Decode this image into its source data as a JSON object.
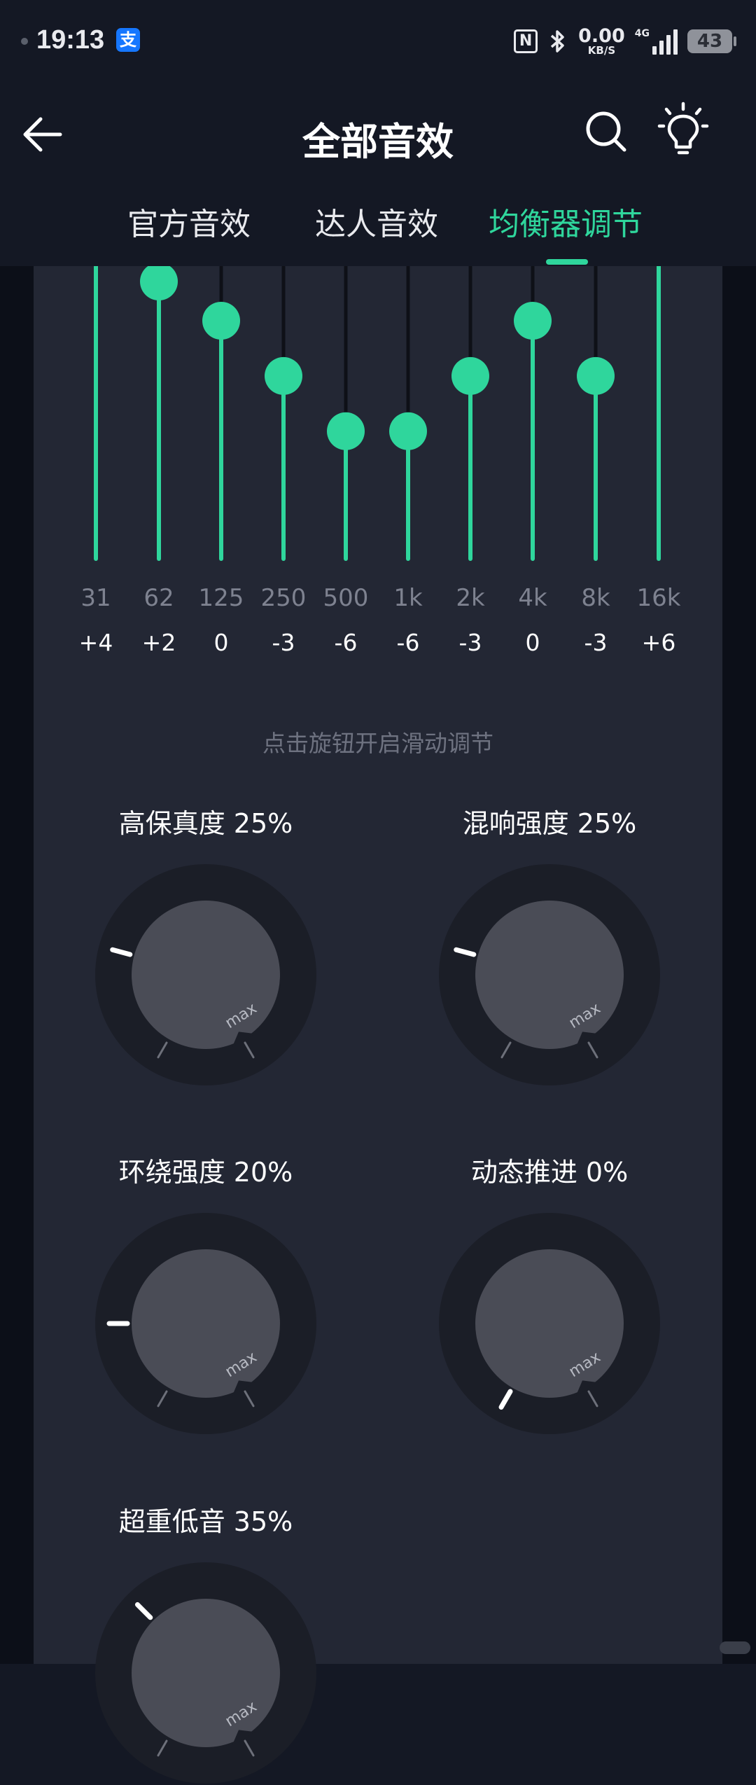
{
  "status_bar": {
    "time": "19:13",
    "alipay_glyph": "支",
    "nfc_label": "N",
    "net_speed_value": "0.00",
    "net_speed_unit": "KB/S",
    "network_type": "4G",
    "battery_level": "43"
  },
  "header": {
    "title": "全部音效",
    "back_icon": "back-arrow-icon",
    "search_icon": "search-icon",
    "tips_icon": "lightbulb-icon"
  },
  "tabs": [
    {
      "label": "官方音效",
      "active": false
    },
    {
      "label": "达人音效",
      "active": false
    },
    {
      "label": "均衡器调节",
      "active": true
    }
  ],
  "equalizer": {
    "bands": [
      {
        "freq": "31",
        "gain": "+4"
      },
      {
        "freq": "62",
        "gain": "+2"
      },
      {
        "freq": "125",
        "gain": "0"
      },
      {
        "freq": "250",
        "gain": "-3"
      },
      {
        "freq": "500",
        "gain": "-6"
      },
      {
        "freq": "1k",
        "gain": "-6"
      },
      {
        "freq": "2k",
        "gain": "-3"
      },
      {
        "freq": "4k",
        "gain": "0"
      },
      {
        "freq": "8k",
        "gain": "-3"
      },
      {
        "freq": "16k",
        "gain": "+6"
      }
    ],
    "hint": "点击旋钮开启滑动调节"
  },
  "knobs": [
    {
      "label": "高保真度 25%",
      "percent": 25
    },
    {
      "label": "混响强度 25%",
      "percent": 25
    },
    {
      "label": "环绕强度 20%",
      "percent": 20
    },
    {
      "label": "动态推进 0%",
      "percent": 0
    },
    {
      "label": "超重低音 35%",
      "percent": 35
    }
  ],
  "knob_max_label": "max",
  "colors": {
    "accent": "#2fd69c",
    "background": "#141824",
    "panel": "#232734",
    "knob_ring": "#1b1e27",
    "knob_face": "#4a4c56"
  }
}
